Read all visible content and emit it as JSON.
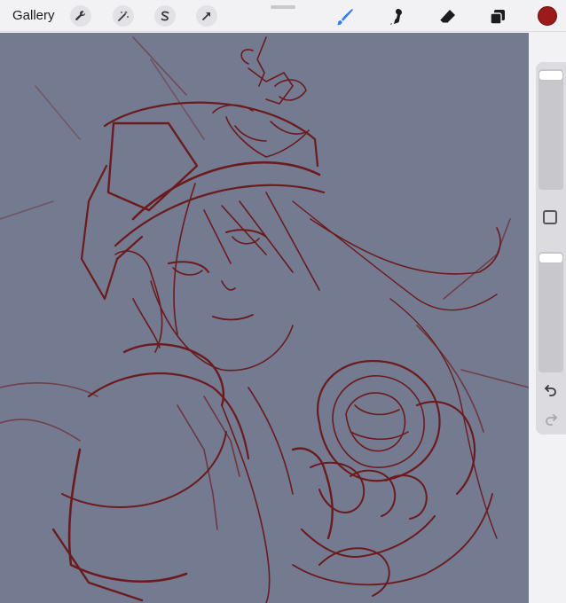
{
  "topbar": {
    "gallery_label": "Gallery",
    "left_tools": [
      "wrench-icon",
      "magic-wand-icon",
      "selection-icon",
      "transform-arrow-icon"
    ],
    "right_tools": [
      "brush-icon",
      "smudge-icon",
      "eraser-icon",
      "layers-icon"
    ],
    "active_tool": "brush-icon",
    "accent_color": "#2f7cf6",
    "current_color": "#9b1b1b"
  },
  "canvas": {
    "background_color": "#747a90",
    "sketch_color": "#6b1111"
  },
  "sidebar": {
    "icons": [
      "modify-square-icon",
      "undo-icon",
      "redo-icon"
    ],
    "redo_enabled": false
  }
}
